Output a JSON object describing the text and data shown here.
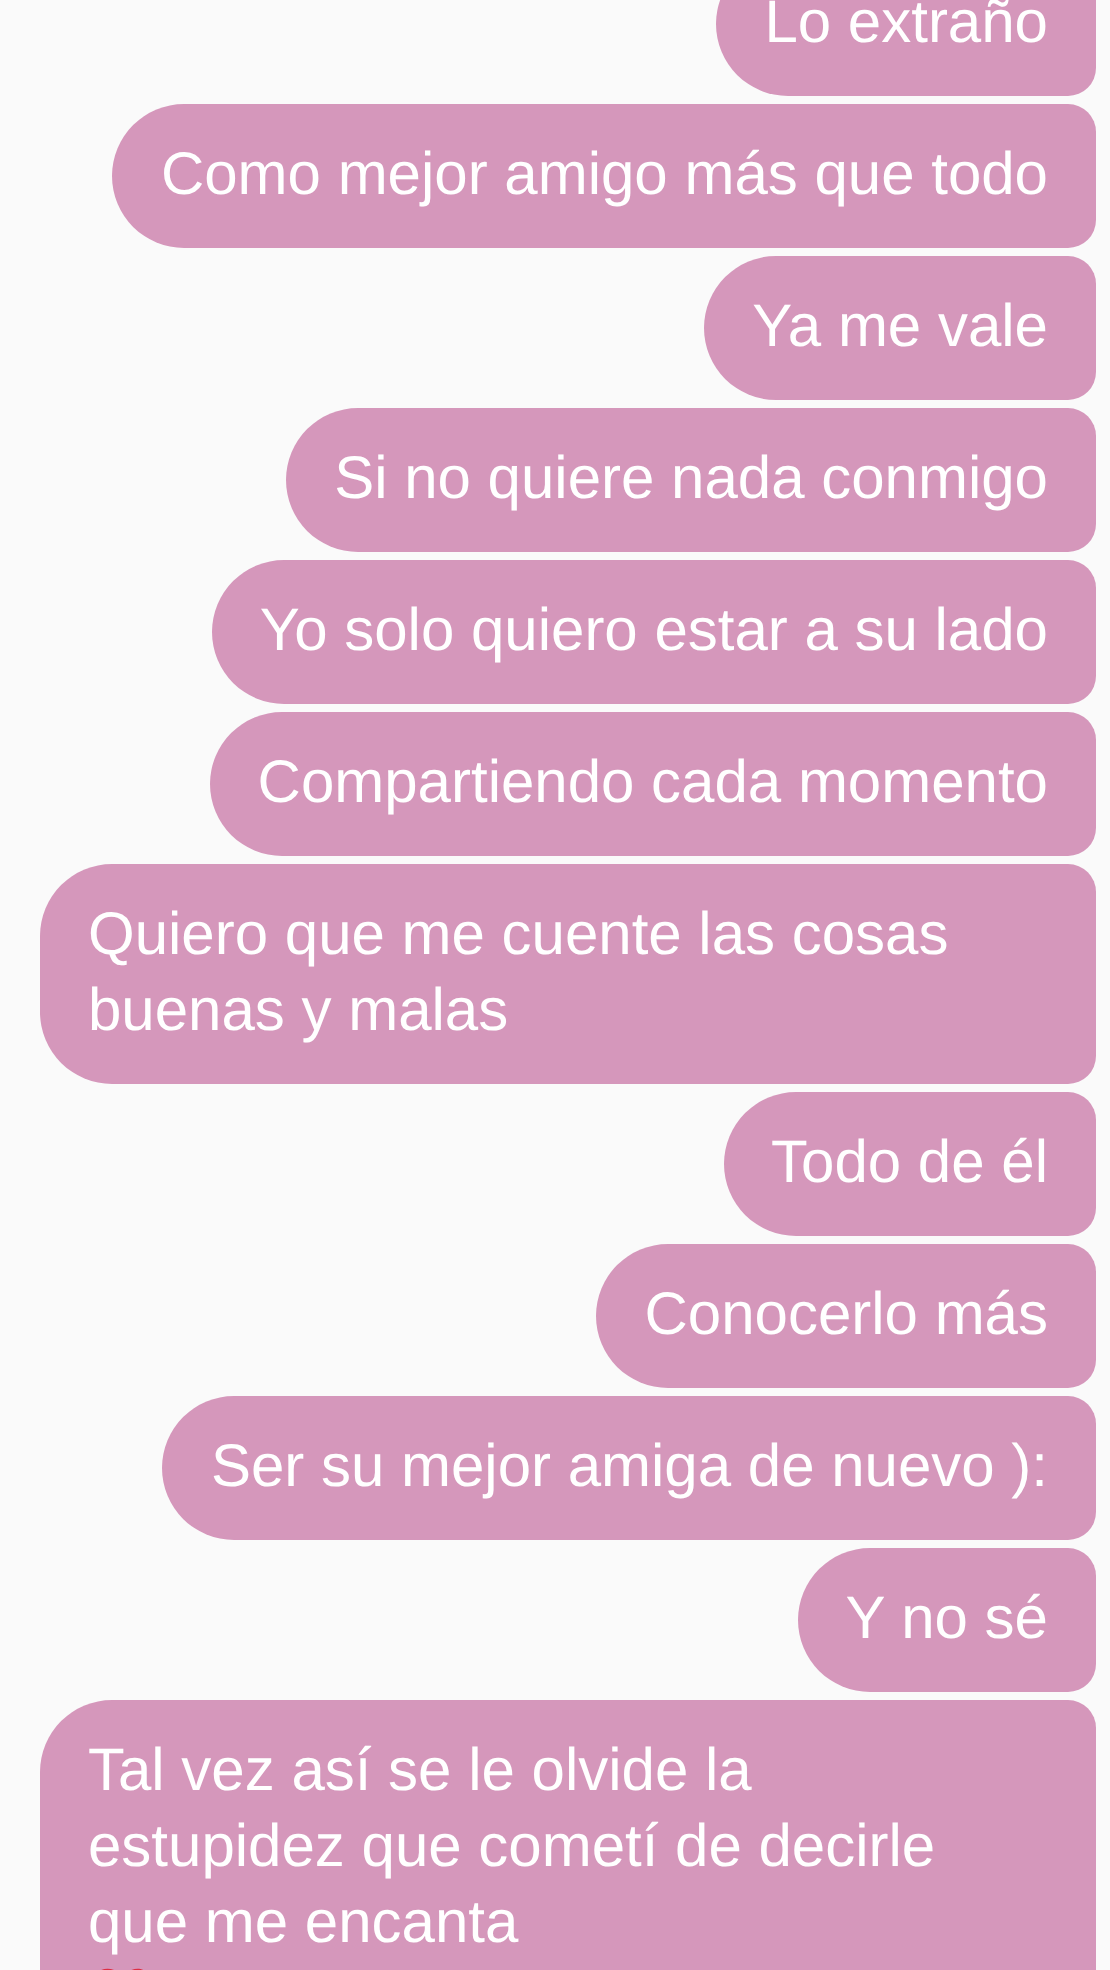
{
  "messages": [
    {
      "kind": "plain",
      "text": "Lo extraño"
    },
    {
      "kind": "plain",
      "text": "Como mejor amigo más que todo"
    },
    {
      "kind": "plain",
      "text": "Ya me vale"
    },
    {
      "kind": "plain",
      "text": "Si no quiere nada conmigo"
    },
    {
      "kind": "plain",
      "text": "Yo solo quiero estar a su lado"
    },
    {
      "kind": "plain",
      "text": "Compartiendo cada momento"
    },
    {
      "kind": "plain",
      "text": "Quiero que me cuente las cosas buenas y malas"
    },
    {
      "kind": "plain",
      "text": "Todo de él"
    },
    {
      "kind": "plain",
      "text": "Conocerlo más"
    },
    {
      "kind": "plain",
      "text": "Ser su mejor amiga de nuevo ):"
    },
    {
      "kind": "plain",
      "text": "Y no sé"
    },
    {
      "kind": "heart",
      "text": "Tal vez así se le olvide la estupidez que cometí de decirle que me encanta"
    }
  ]
}
